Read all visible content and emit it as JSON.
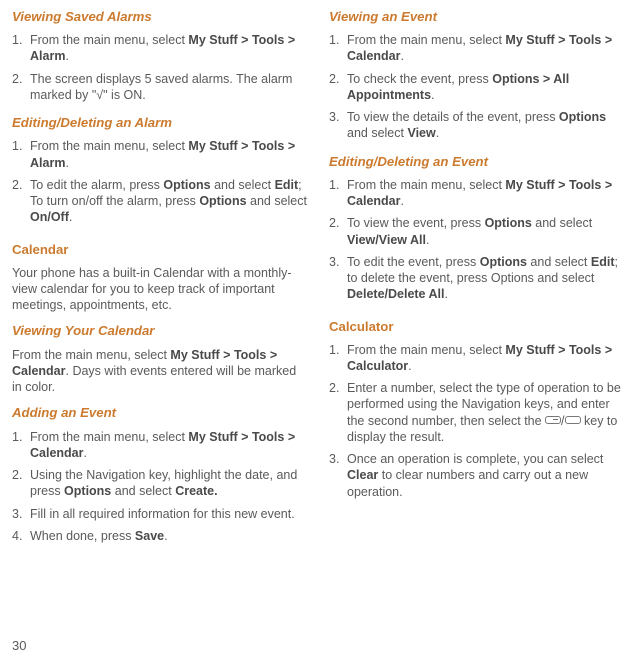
{
  "left": {
    "h1": "Viewing Saved Alarms",
    "list1": [
      "From the main menu, select <b>My Stuff > Tools > Alarm</b>.",
      "The screen displays 5 saved alarms. The alarm marked by \"√\" is ON."
    ],
    "h2": "Editing/Deleting an Alarm",
    "list2": [
      "From the main menu, select <b>My Stuff > Tools > Alarm</b>.",
      "To edit the alarm, press <b>Options</b> and select <b>Edit</b>; To turn on/off the alarm, press <b>Options</b> and select <b>On/Off</b>."
    ],
    "h3": "Calendar",
    "p1": "Your phone has a built-in Calendar with a monthly-view calendar for you to keep track of important meetings, appointments, etc.",
    "h4": "Viewing Your Calendar",
    "p2": "From the main menu, select <b>My Stuff > Tools > Calendar</b>. Days with events entered will be marked in color.",
    "h5": "Adding an Event",
    "list3": [
      "From the main menu, select <b>My Stuff > Tools > Calendar</b>.",
      "Using the Navigation key, highlight the date, and press <b>Options</b> and select <b>Create.</b>",
      "Fill in all required information for this new event.",
      "When done, press <b>Save</b>."
    ]
  },
  "right": {
    "h1": "Viewing an Event",
    "list1": [
      "From the main menu, select <b>My Stuff > Tools > Calendar</b>.",
      "To check the event, press <b>Options > All Appointments</b>.",
      "To view the details of the event, press <b>Options</b> and select <b>View</b>."
    ],
    "h2": "Editing/Deleting an Event",
    "list2": [
      "From the main menu, select <b>My Stuff > Tools > Calendar</b>.",
      "To view the event, press <b>Options</b> and select <b>View/View All</b>.",
      "To edit the event, press <b>Options</b> and select <b>Edit</b>; to delete the event, press Options and select <b>Delete/Delete All</b>."
    ],
    "h3": "Calculator",
    "list3": [
      "From the main menu, select <b>My Stuff > Tools > Calculator</b>.",
      "Enter a number, select the type of operation to be performed using the Navigation keys, and enter the second number, then select the <span class=\"keybox left\"></span>/<span class=\"keybox\"></span> key to display the result.",
      "Once an operation is complete, you can select <b>Clear</b> to clear numbers and carry out a new operation."
    ]
  },
  "page_number": "30"
}
